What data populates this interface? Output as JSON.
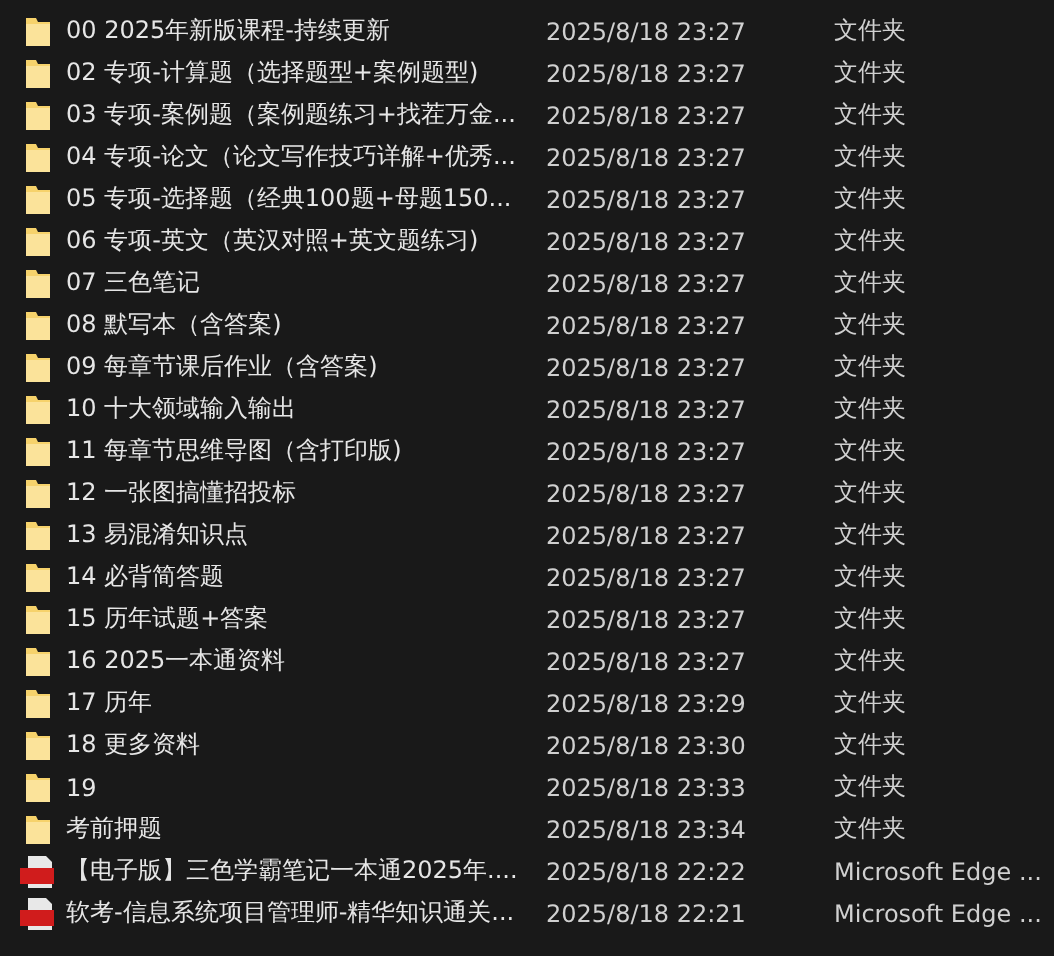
{
  "files": [
    {
      "kind": "folder",
      "name": "00 2025年新版课程-持续更新",
      "date": "2025/8/18 23:27",
      "type": "文件夹"
    },
    {
      "kind": "folder",
      "name": "02 专项-计算题（选择题型+案例题型)",
      "date": "2025/8/18 23:27",
      "type": "文件夹"
    },
    {
      "kind": "folder",
      "name": "03 专项-案例题（案例题练习+找茬万金...",
      "date": "2025/8/18 23:27",
      "type": "文件夹"
    },
    {
      "kind": "folder",
      "name": "04 专项-论文（论文写作技巧详解+优秀...",
      "date": "2025/8/18 23:27",
      "type": "文件夹"
    },
    {
      "kind": "folder",
      "name": "05 专项-选择题（经典100题+母题150...",
      "date": "2025/8/18 23:27",
      "type": "文件夹"
    },
    {
      "kind": "folder",
      "name": "06 专项-英文（英汉对照+英文题练习)",
      "date": "2025/8/18 23:27",
      "type": "文件夹"
    },
    {
      "kind": "folder",
      "name": "07 三色笔记",
      "date": "2025/8/18 23:27",
      "type": "文件夹"
    },
    {
      "kind": "folder",
      "name": "08 默写本（含答案)",
      "date": "2025/8/18 23:27",
      "type": "文件夹"
    },
    {
      "kind": "folder",
      "name": "09 每章节课后作业（含答案)",
      "date": "2025/8/18 23:27",
      "type": "文件夹"
    },
    {
      "kind": "folder",
      "name": "10 十大领域输入输出",
      "date": "2025/8/18 23:27",
      "type": "文件夹"
    },
    {
      "kind": "folder",
      "name": "11 每章节思维导图（含打印版)",
      "date": "2025/8/18 23:27",
      "type": "文件夹"
    },
    {
      "kind": "folder",
      "name": "12 一张图搞懂招投标",
      "date": "2025/8/18 23:27",
      "type": "文件夹"
    },
    {
      "kind": "folder",
      "name": "13 易混淆知识点",
      "date": "2025/8/18 23:27",
      "type": "文件夹"
    },
    {
      "kind": "folder",
      "name": "14 必背简答题",
      "date": "2025/8/18 23:27",
      "type": "文件夹"
    },
    {
      "kind": "folder",
      "name": "15 历年试题+答案",
      "date": "2025/8/18 23:27",
      "type": "文件夹"
    },
    {
      "kind": "folder",
      "name": "16 2025一本通资料",
      "date": "2025/8/18 23:27",
      "type": "文件夹"
    },
    {
      "kind": "folder",
      "name": "17 历年",
      "date": "2025/8/18 23:29",
      "type": "文件夹"
    },
    {
      "kind": "folder",
      "name": "18 更多资料",
      "date": "2025/8/18 23:30",
      "type": "文件夹"
    },
    {
      "kind": "folder",
      "name": "19",
      "date": "2025/8/18 23:33",
      "type": "文件夹"
    },
    {
      "kind": "folder",
      "name": "考前押题",
      "date": "2025/8/18 23:34",
      "type": "文件夹"
    },
    {
      "kind": "pdf",
      "name": "【电子版】三色学霸笔记一本通2025年....",
      "date": "2025/8/18 22:22",
      "type": "Microsoft Edge ..."
    },
    {
      "kind": "pdf",
      "name": "软考-信息系统项目管理师-精华知识通关...",
      "date": "2025/8/18 22:21",
      "type": "Microsoft Edge ..."
    }
  ]
}
